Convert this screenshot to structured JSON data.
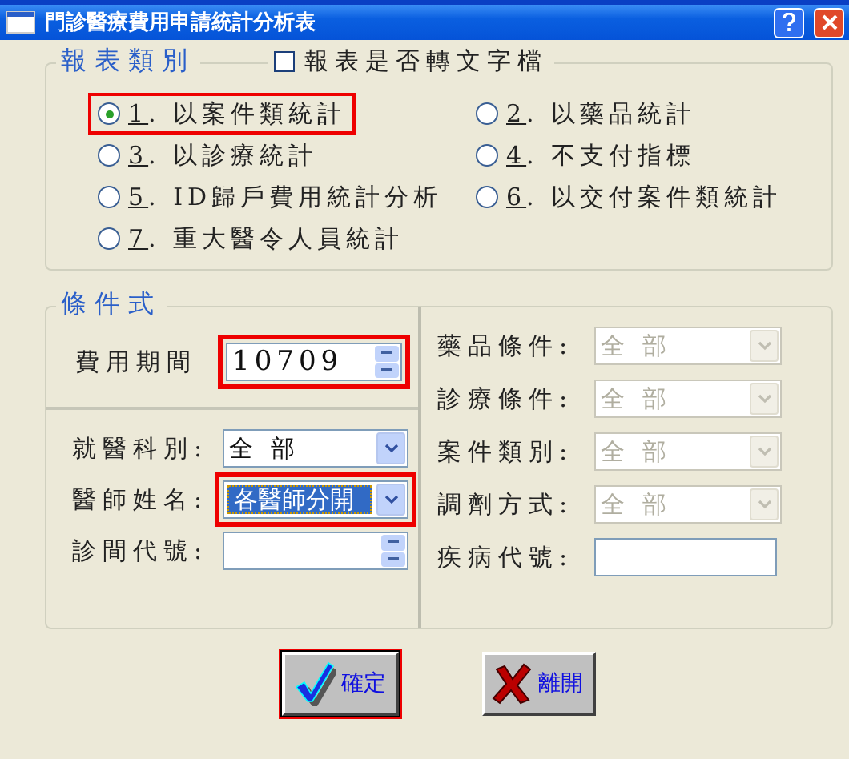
{
  "window": {
    "title": "門診醫療費用申請統計分析表"
  },
  "report_type": {
    "legend": "報表類別",
    "export_text": {
      "label": "報表是否轉文字檔",
      "checked": false
    },
    "options": [
      {
        "label": "1. 以案件類統計",
        "selected": true,
        "highlighted": true
      },
      {
        "label": "2. 以藥品統計",
        "selected": false,
        "highlighted": false
      },
      {
        "label": "3. 以診療統計",
        "selected": false,
        "highlighted": false
      },
      {
        "label": "4. 不支付指標",
        "selected": false,
        "highlighted": false
      },
      {
        "label": "5. ID歸戶費用統計分析",
        "selected": false,
        "highlighted": false
      },
      {
        "label": "6. 以交付案件類統計",
        "selected": false,
        "highlighted": false
      },
      {
        "label": "7. 重大醫令人員統計",
        "selected": false,
        "highlighted": false
      }
    ]
  },
  "conditions": {
    "legend": "條件式",
    "period": {
      "label": "費用期間",
      "value": "10709",
      "highlighted": true
    },
    "left_fields": [
      {
        "kind": "combo",
        "label": "就醫科別:",
        "value": "全 部",
        "selected": false
      },
      {
        "kind": "combo",
        "label": "醫師姓名:",
        "value": "各醫師分開",
        "selected": true,
        "highlighted": true
      },
      {
        "kind": "spin",
        "label": "診間代號:"
      }
    ],
    "right_fields": [
      {
        "kind": "combo",
        "label": "藥品條件:",
        "value": "全 部",
        "disabled": true
      },
      {
        "kind": "combo",
        "label": "診療條件:",
        "value": "全 部",
        "disabled": true
      },
      {
        "kind": "combo",
        "label": "案件類別:",
        "value": "全 部",
        "disabled": true
      },
      {
        "kind": "combo",
        "label": "調劑方式:",
        "value": "全 部",
        "disabled": true
      },
      {
        "kind": "text",
        "label": "疾病代號:",
        "disabled": false
      }
    ]
  },
  "buttons": [
    {
      "kind": "ok",
      "label": "確定",
      "highlighted": true
    },
    {
      "kind": "exit",
      "label": "離開",
      "highlighted": false
    }
  ]
}
